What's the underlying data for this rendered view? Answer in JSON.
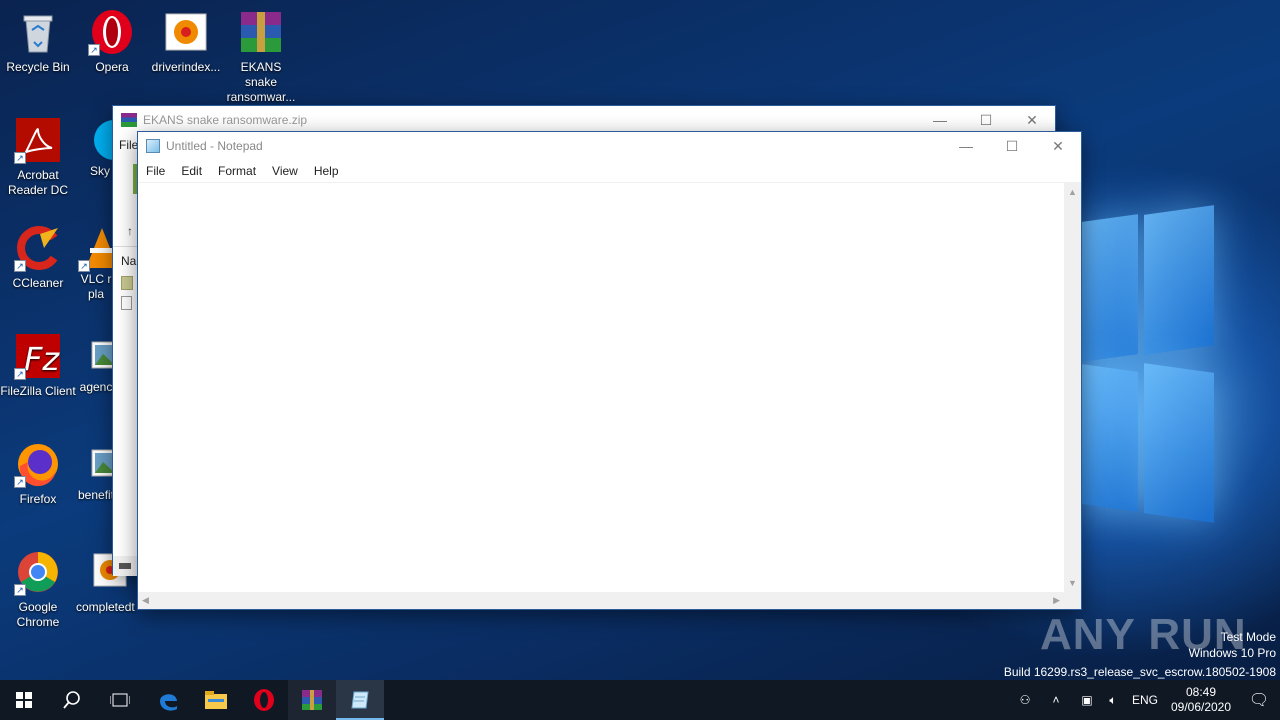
{
  "desktop": {
    "icons": [
      {
        "label": "Recycle Bin",
        "icon": "recycle-bin-icon"
      },
      {
        "label": "Opera",
        "icon": "opera-icon"
      },
      {
        "label": "driverindex...",
        "icon": "image-file-icon"
      },
      {
        "label": "EKANS snake ransomwar...",
        "icon": "winrar-archive-icon"
      },
      {
        "label": "Acrobat Reader DC",
        "icon": "acrobat-icon"
      },
      {
        "label": "Sky",
        "icon": "skype-icon"
      },
      {
        "label": "CCleaner",
        "icon": "ccleaner-icon"
      },
      {
        "label": "VLC r pla",
        "icon": "vlc-icon"
      },
      {
        "label": "FileZilla Client",
        "icon": "filezilla-icon"
      },
      {
        "label": "agenc",
        "icon": "image-file-icon"
      },
      {
        "label": "Firefox",
        "icon": "firefox-icon"
      },
      {
        "label": "benefit",
        "icon": "image-file-icon"
      },
      {
        "label": "Google Chrome",
        "icon": "chrome-icon"
      },
      {
        "label": "completedt",
        "icon": "image-file-icon"
      }
    ]
  },
  "winrar_window": {
    "title": "EKANS snake ransomware.zip",
    "menu_first": "File",
    "column_header": "Nar"
  },
  "notepad_window": {
    "title": "Untitled - Notepad",
    "menu": [
      "File",
      "Edit",
      "Format",
      "View",
      "Help"
    ],
    "content": ""
  },
  "watermark": {
    "line1": "Test Mode",
    "line2": "Windows 10 Pro",
    "line3": "Build 16299.rs3_release_svc_escrow.180502-1908",
    "brand": "ANY RUN"
  },
  "taskbar": {
    "items": [
      "start-icon",
      "search-icon",
      "task-view-icon",
      "edge-icon",
      "file-explorer-icon",
      "opera-icon",
      "winrar-icon",
      "notepad-icon"
    ],
    "active": "notepad-icon",
    "tray": {
      "language": "ENG",
      "time": "08:49",
      "date": "09/06/2020"
    }
  },
  "colors": {
    "taskbar_bg": "#101824",
    "active_underline": "#76b9ed",
    "window_border": "#2c5b9b"
  }
}
